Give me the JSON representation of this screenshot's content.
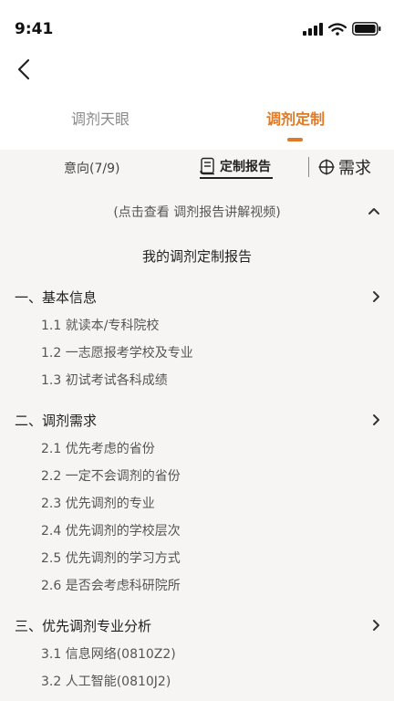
{
  "status_bar": {
    "time": "9:41"
  },
  "tabs": [
    {
      "label": "调剂天眼"
    },
    {
      "label": "调剂定制"
    }
  ],
  "toolbar": {
    "intent": "意向(7/9)",
    "report": "定制报告",
    "needs": "需求"
  },
  "video_hint": "(点击查看 调剂报告讲解视频)",
  "report_title": "我的调剂定制报告",
  "sections": [
    {
      "title": "一、基本信息",
      "items": [
        "1.1 就读本/专科院校",
        "1.2 一志愿报考学校及专业",
        "1.3 初试考试各科成绩"
      ]
    },
    {
      "title": "二、调剂需求",
      "items": [
        "2.1 优先考虑的省份",
        "2.2 一定不会调剂的省份",
        "2.3 优先调剂的专业",
        "2.4 优先调剂的学校层次",
        "2.5 优先调剂的学习方式",
        "2.6 是否会考虑科研院所"
      ]
    },
    {
      "title": "三、优先调剂专业分析",
      "items": [
        "3.1 信息网络(0810Z2)",
        "3.2 人工智能(0810J2)"
      ]
    }
  ],
  "colors": {
    "accent": "#e07a24"
  },
  "icons": [
    "signal-icon",
    "wifi-icon",
    "battery-icon",
    "back-arrow-icon",
    "report-scroll-icon",
    "crosshair-icon",
    "chevron-up-icon",
    "chevron-right-icon"
  ]
}
